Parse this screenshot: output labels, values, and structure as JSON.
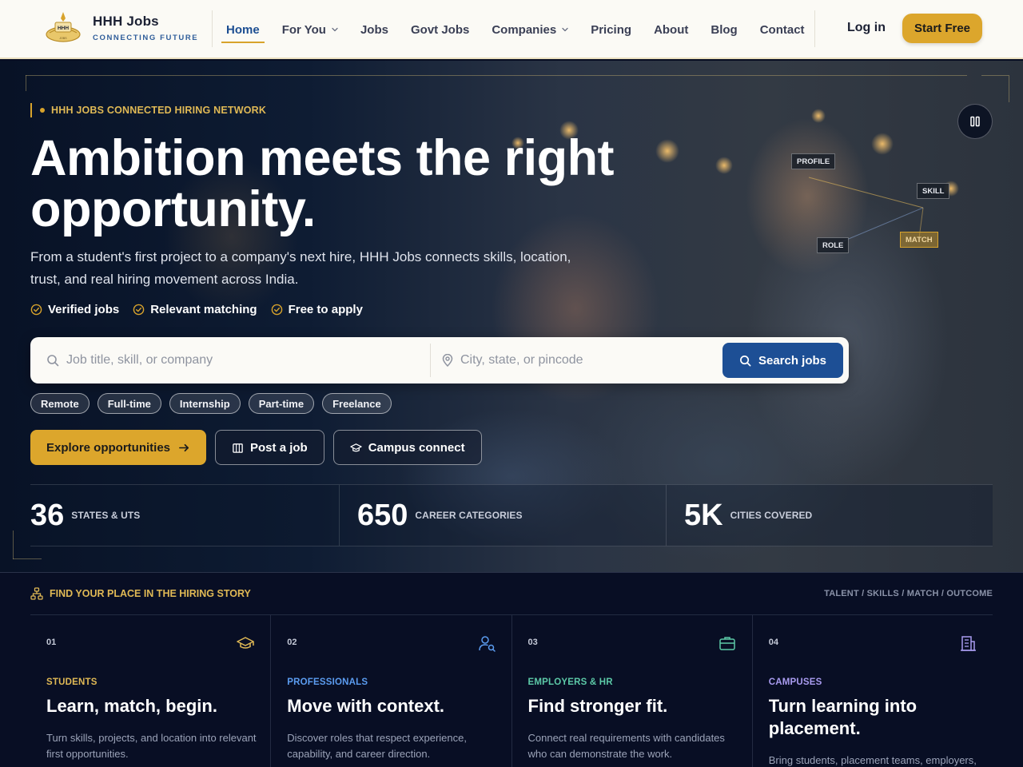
{
  "nav": {
    "brand_name": "HHH Jobs",
    "brand_tagline": "CONNECTING FUTURE",
    "links": [
      {
        "label": "Home",
        "active": true,
        "dropdown": false
      },
      {
        "label": "For You",
        "active": false,
        "dropdown": true
      },
      {
        "label": "Jobs",
        "active": false,
        "dropdown": false
      },
      {
        "label": "Govt Jobs",
        "active": false,
        "dropdown": false
      },
      {
        "label": "Companies",
        "active": false,
        "dropdown": true
      },
      {
        "label": "Pricing",
        "active": false,
        "dropdown": false
      },
      {
        "label": "About",
        "active": false,
        "dropdown": false
      },
      {
        "label": "Blog",
        "active": false,
        "dropdown": false
      },
      {
        "label": "Contact",
        "active": false,
        "dropdown": false
      }
    ],
    "login_label": "Log in",
    "start_label": "Start Free"
  },
  "hero": {
    "eyebrow": "HHH JOBS CONNECTED HIRING NETWORK",
    "headline": "Ambition meets the right opportunity.",
    "subtext": "From a student's first project to a company's next hire, HHH Jobs connects skills, location, trust, and real hiring movement across India.",
    "checks": [
      "Verified jobs",
      "Relevant matching",
      "Free to apply"
    ],
    "search": {
      "keyword_placeholder": "Job title, skill, or company",
      "location_placeholder": "City, state, or pincode",
      "button_label": "Search jobs"
    },
    "chips": [
      "Remote",
      "Full-time",
      "Internship",
      "Part-time",
      "Freelance"
    ],
    "ctas": {
      "explore": "Explore opportunities",
      "post": "Post a job",
      "campus": "Campus connect"
    },
    "stats": [
      {
        "value": "36",
        "label": "STATES & UTS"
      },
      {
        "value": "650",
        "label": "CAREER CATEGORIES"
      },
      {
        "value": "5K",
        "label": "CITIES COVERED"
      }
    ],
    "tags": {
      "profile": "PROFILE",
      "skill": "SKILL",
      "role": "ROLE",
      "match": "MATCH"
    }
  },
  "section": {
    "heading": "FIND YOUR PLACE IN THE HIRING STORY",
    "right_label": "TALENT / SKILLS / MATCH / OUTCOME",
    "cards": [
      {
        "num": "01",
        "kicker": "STUDENTS",
        "title": "Learn, match, begin.",
        "desc": "Turn skills, projects, and location into relevant first opportunities.",
        "color": "#e0b955",
        "icon": "graduation-cap-icon"
      },
      {
        "num": "02",
        "kicker": "PROFESSIONALS",
        "title": "Move with context.",
        "desc": "Discover roles that respect experience, capability, and career direction.",
        "color": "#5b9cf0",
        "icon": "user-search-icon"
      },
      {
        "num": "03",
        "kicker": "EMPLOYERS & HR",
        "title": "Find stronger fit.",
        "desc": "Connect real requirements with candidates who can demonstrate the work.",
        "color": "#5cc9a7",
        "icon": "briefcase-icon"
      },
      {
        "num": "04",
        "kicker": "CAMPUSES",
        "title": "Turn learning into placement.",
        "desc": "Bring students, placement teams, employers, and outcomes into one flow.",
        "color": "#a99cf0",
        "icon": "building-icon"
      }
    ]
  }
}
